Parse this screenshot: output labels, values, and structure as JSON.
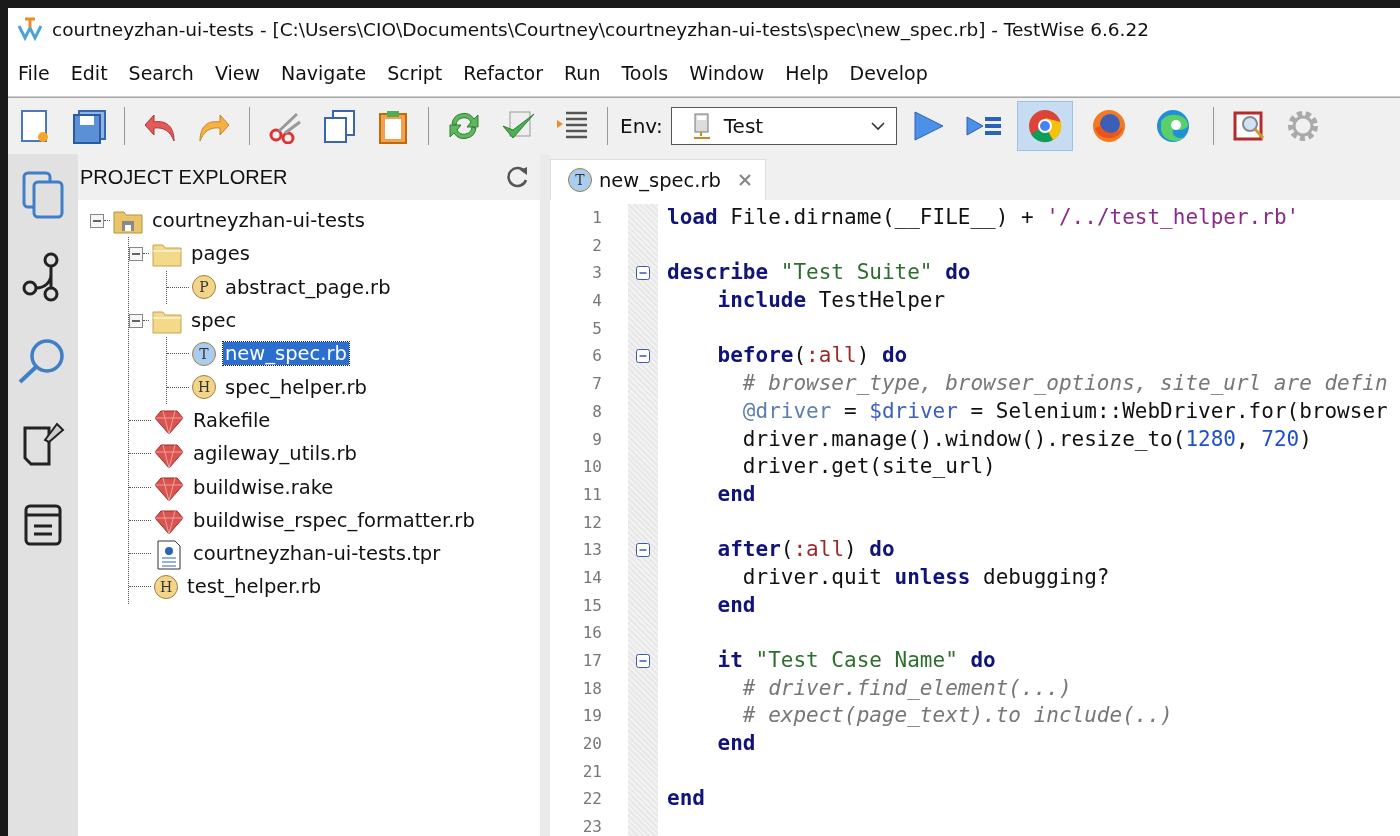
{
  "window": {
    "title": "courtneyzhan-ui-tests - [C:\\Users\\CIO\\Documents\\Courtney\\courtneyzhan-ui-tests\\spec\\new_spec.rb] - TestWise 6.6.22"
  },
  "menu": [
    "File",
    "Edit",
    "Search",
    "View",
    "Navigate",
    "Script",
    "Refactor",
    "Run",
    "Tools",
    "Window",
    "Help",
    "Develop"
  ],
  "toolbar": {
    "env_label": "Env:",
    "env_value": "Test",
    "browsers": [
      {
        "kind": "chrome",
        "selected": true
      },
      {
        "kind": "firefox",
        "selected": false
      },
      {
        "kind": "edge",
        "selected": false
      }
    ]
  },
  "explorer": {
    "title": "PROJECT EXPLORER",
    "tree": [
      {
        "label": "courtneyzhan-ui-tests",
        "kind": "project",
        "expanded": true,
        "selected": false,
        "children": [
          {
            "label": "pages",
            "kind": "folder",
            "expanded": true,
            "selected": false,
            "children": [
              {
                "label": "abstract_page.rb",
                "kind": "page",
                "badge": "P",
                "selected": false
              }
            ]
          },
          {
            "label": "spec",
            "kind": "folder",
            "expanded": true,
            "selected": false,
            "children": [
              {
                "label": "new_spec.rb",
                "kind": "test",
                "badge": "T",
                "selected": true
              },
              {
                "label": "spec_helper.rb",
                "kind": "helper",
                "badge": "H",
                "selected": false
              }
            ]
          },
          {
            "label": "Rakefile",
            "kind": "ruby",
            "selected": false
          },
          {
            "label": "agileway_utils.rb",
            "kind": "ruby",
            "selected": false
          },
          {
            "label": "buildwise.rake",
            "kind": "ruby",
            "selected": false
          },
          {
            "label": "buildwise_rspec_formatter.rb",
            "kind": "ruby",
            "selected": false
          },
          {
            "label": "courtneyzhan-ui-tests.tpr",
            "kind": "projectfile",
            "selected": false
          },
          {
            "label": "test_helper.rb",
            "kind": "helper",
            "badge": "H",
            "selected": false
          }
        ]
      }
    ]
  },
  "editor": {
    "tabs": [
      {
        "label": "new_spec.rb",
        "kind": "test",
        "badge": "T",
        "selected": true
      }
    ],
    "lines": [
      {
        "number": "1",
        "foldable": false,
        "tokens": [
          {
            "kind": "kw",
            "text": "load"
          },
          {
            "kind": "plain",
            "text": " File.dirname(__FILE__) + "
          },
          {
            "kind": "sstr",
            "text": "'/../test_helper.rb'"
          }
        ]
      },
      {
        "number": "2",
        "foldable": false
      },
      {
        "number": "3",
        "foldable": true,
        "tokens": [
          {
            "kind": "kw",
            "text": "describe"
          },
          {
            "kind": "str",
            "text": " \"Test Suite\" "
          },
          {
            "kind": "kw",
            "text": "do"
          }
        ]
      },
      {
        "number": "4",
        "foldable": false,
        "tokens": [
          {
            "kind": "kw",
            "text": "    include"
          },
          {
            "kind": "plain",
            "text": " TestHelper"
          }
        ]
      },
      {
        "number": "5",
        "foldable": false
      },
      {
        "number": "6",
        "foldable": true,
        "tokens": [
          {
            "kind": "kw",
            "text": "    before"
          },
          {
            "kind": "plain",
            "text": "("
          },
          {
            "kind": "sym",
            "text": ":all"
          },
          {
            "kind": "plain",
            "text": ") "
          },
          {
            "kind": "kw",
            "text": "do"
          }
        ]
      },
      {
        "number": "7",
        "foldable": false,
        "tokens": [
          {
            "kind": "comment",
            "text": "      # browser_type, browser_options, site_url are defin"
          }
        ]
      },
      {
        "number": "8",
        "foldable": false,
        "tokens": [
          {
            "kind": "ivar",
            "text": "      @driver"
          },
          {
            "kind": "plain",
            "text": " = "
          },
          {
            "kind": "gvar",
            "text": "$driver"
          },
          {
            "kind": "plain",
            "text": " = Selenium::WebDriver.for(browser"
          }
        ]
      },
      {
        "number": "9",
        "foldable": false,
        "tokens": [
          {
            "kind": "plain",
            "text": "      driver.manage().window().resize_to("
          },
          {
            "kind": "num",
            "text": "1280"
          },
          {
            "kind": "plain",
            "text": ", "
          },
          {
            "kind": "num",
            "text": "720"
          },
          {
            "kind": "plain",
            "text": ")"
          }
        ]
      },
      {
        "number": "10",
        "foldable": false,
        "tokens": [
          {
            "kind": "plain",
            "text": "      driver.get(site_url)"
          }
        ]
      },
      {
        "number": "11",
        "foldable": false,
        "tokens": [
          {
            "kind": "kw",
            "text": "    end"
          }
        ]
      },
      {
        "number": "12",
        "foldable": false
      },
      {
        "number": "13",
        "foldable": true,
        "tokens": [
          {
            "kind": "kw",
            "text": "    after"
          },
          {
            "kind": "plain",
            "text": "("
          },
          {
            "kind": "sym",
            "text": ":all"
          },
          {
            "kind": "plain",
            "text": ") "
          },
          {
            "kind": "kw",
            "text": "do"
          }
        ]
      },
      {
        "number": "14",
        "foldable": false,
        "tokens": [
          {
            "kind": "plain",
            "text": "      driver.quit "
          },
          {
            "kind": "kw",
            "text": "unless"
          },
          {
            "kind": "plain",
            "text": " debugging?"
          }
        ]
      },
      {
        "number": "15",
        "foldable": false,
        "tokens": [
          {
            "kind": "kw",
            "text": "    end"
          }
        ]
      },
      {
        "number": "16",
        "foldable": false
      },
      {
        "number": "17",
        "foldable": true,
        "tokens": [
          {
            "kind": "kw",
            "text": "    it"
          },
          {
            "kind": "str",
            "text": " \"Test Case Name\" "
          },
          {
            "kind": "kw",
            "text": "do"
          }
        ]
      },
      {
        "number": "18",
        "foldable": false,
        "tokens": [
          {
            "kind": "comment",
            "text": "      # driver.find_element(...)"
          }
        ]
      },
      {
        "number": "19",
        "foldable": false,
        "tokens": [
          {
            "kind": "comment",
            "text": "      # expect(page_text).to include(..)"
          }
        ]
      },
      {
        "number": "20",
        "foldable": false,
        "tokens": [
          {
            "kind": "kw",
            "text": "    end"
          }
        ]
      },
      {
        "number": "21",
        "foldable": false
      },
      {
        "number": "22",
        "foldable": false,
        "tokens": [
          {
            "kind": "kw",
            "text": "end"
          }
        ]
      },
      {
        "number": "23",
        "foldable": false
      }
    ]
  }
}
